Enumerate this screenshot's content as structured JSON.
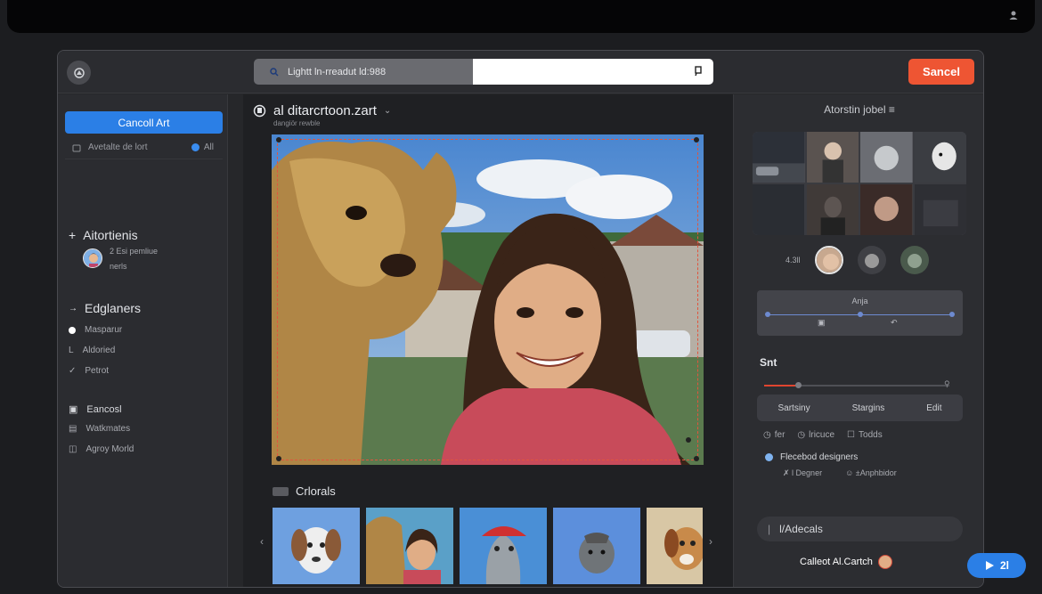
{
  "header": {
    "search_text": "Lightt ln-rreadut ld:988",
    "cancel_button": "Sancel"
  },
  "sidebar": {
    "primary_button": "Cancoll Art",
    "search_label": "Avetalte de lort",
    "all_label": "All",
    "section1_title": "Aitortienis",
    "avatar_line1": "2 Esi pemliue",
    "avatar_line2": "nerls",
    "section2_title": "Edglaners",
    "items": [
      "Masparur",
      "Aldoried",
      "Petrot"
    ],
    "tools": [
      "Eancosl",
      "Watkmates",
      "Agroy Morld"
    ]
  },
  "main": {
    "title": "al ditarcrtoon.zart",
    "subtitle": "dangiör rewble",
    "thumbs_title": "Crlorals"
  },
  "right": {
    "title": "Atorstin jobel",
    "face_label": "4.3ll",
    "ang_label": "Anja",
    "sat_label": "Snt",
    "slider_value_pct": 17,
    "segments": [
      "Sartsiny",
      "Stargins",
      "Edit"
    ],
    "checks": [
      "fer",
      "lricuce",
      "Todds"
    ],
    "radio_label": "Flecebod designers",
    "sub_items": [
      "l Degner",
      "±Anphbidor"
    ],
    "adecals": "l/Adecals"
  },
  "footer": {
    "label": "Calleot Al.Cartch",
    "fab_label": "2l"
  },
  "colors": {
    "accent": "#2b7fe6",
    "danger": "#ee5533",
    "panel": "#2b2c30",
    "background": "#1c1d20"
  }
}
